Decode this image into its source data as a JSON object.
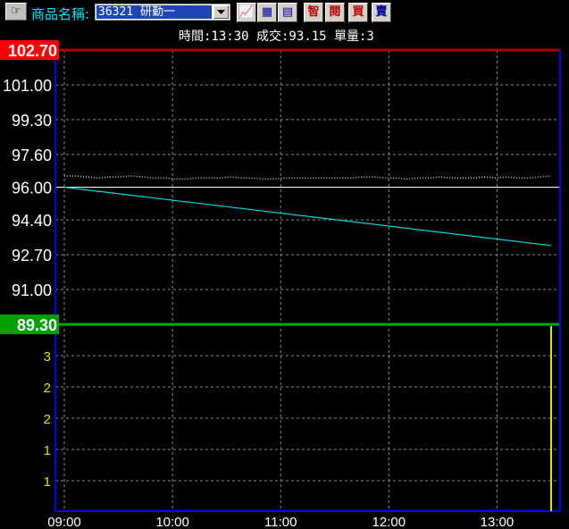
{
  "toolbar": {
    "product_label": "商品名稱:",
    "product_value": "36321 研勤一",
    "buttons": [
      {
        "name": "chart-type-button",
        "label": "📈",
        "color": "blue"
      },
      {
        "name": "calculator-button",
        "label": "▦",
        "color": "blue"
      },
      {
        "name": "document-button",
        "label": "▤",
        "color": "blue"
      },
      {
        "name": "smart-button",
        "label": "智",
        "color": "red"
      },
      {
        "name": "read-button",
        "label": "閱",
        "color": "red"
      },
      {
        "name": "buy-button",
        "label": "買",
        "color": "red"
      },
      {
        "name": "sell-button",
        "label": "賣",
        "color": "blue"
      }
    ]
  },
  "info": {
    "text": "時間:13:30 成交:93.15 單量:3"
  },
  "chart_data": [
    {
      "type": "line",
      "panel": "price",
      "ylim": [
        89.3,
        102.7
      ],
      "ticks": [
        102.7,
        101.0,
        99.3,
        97.6,
        96.0,
        94.4,
        92.7,
        91.0,
        89.3
      ],
      "tick_labels": [
        "102.70",
        "101.00",
        "99.30",
        "97.60",
        "96.00",
        "94.40",
        "92.70",
        "91.00",
        "89.30"
      ],
      "upper_limit": "102.70",
      "lower_limit": "89.30",
      "reference": 96.0,
      "series": [
        {
          "color": "#00d8d8",
          "x": [
            "09:00",
            "13:30"
          ],
          "values": [
            96.0,
            93.15
          ]
        },
        {
          "color": "#c8c8c8",
          "values": [
            96.55,
            96.55,
            96.5,
            96.45,
            96.5,
            96.5,
            96.55,
            96.5,
            96.45,
            96.45,
            96.4,
            96.4,
            96.45,
            96.45,
            96.45,
            96.5,
            96.45,
            96.45,
            96.4,
            96.4,
            96.45,
            96.45,
            96.45,
            96.45,
            96.45,
            96.45,
            96.45,
            96.5,
            96.5,
            96.45,
            96.45,
            96.4,
            96.45,
            96.45,
            96.5,
            96.45,
            96.45,
            96.45,
            96.5,
            96.45,
            96.5,
            96.45,
            96.45,
            96.5,
            96.55
          ]
        }
      ],
      "colors": {
        "upper": "#aa0000",
        "lower": "#00aa00",
        "grid": "#8a8a8a",
        "axis": "#0000ff"
      }
    },
    {
      "type": "bar",
      "panel": "volume",
      "tick_labels": [
        "3",
        "2",
        "2",
        "1",
        "1"
      ],
      "values": [
        3
      ],
      "color": "#e0e000"
    }
  ],
  "x_axis": {
    "labels": [
      "09:00",
      "10:00",
      "11:00",
      "12:00",
      "13:00"
    ]
  }
}
